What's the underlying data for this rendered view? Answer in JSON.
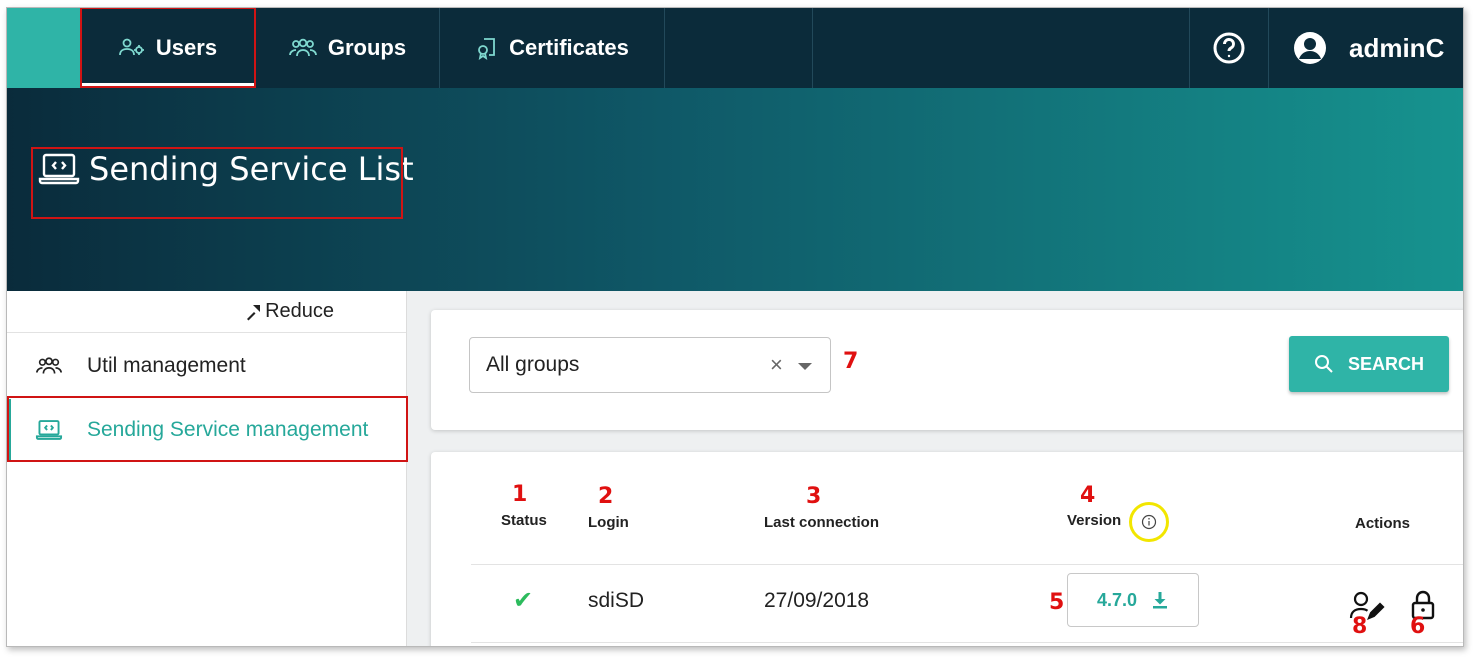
{
  "nav": {
    "tabs": [
      {
        "label": "Users",
        "icon": "users-gear-icon"
      },
      {
        "label": "Groups",
        "icon": "groups-icon"
      },
      {
        "label": "Certificates",
        "icon": "certificate-icon"
      }
    ],
    "help_icon": "help-circle-icon",
    "user_icon": "account-circle-icon",
    "user_name": "adminC"
  },
  "banner": {
    "title": "Sending Service List",
    "icon": "laptop-code-icon"
  },
  "sidebar": {
    "reduce_label": "Reduce",
    "reduce_icon": "collapse-arrows-icon",
    "items": [
      {
        "label": "Util management",
        "icon": "groups-icon"
      },
      {
        "label": "Sending Service management",
        "icon": "laptop-code-icon"
      }
    ]
  },
  "search": {
    "group_select_value": "All groups",
    "clear_symbol": "×",
    "button_label": "SEARCH"
  },
  "table": {
    "headers": {
      "status": "Status",
      "login": "Login",
      "last_connection": "Last connection",
      "version": "Version",
      "actions": "Actions"
    },
    "rows": [
      {
        "status": "✔",
        "login": "sdiSD",
        "last_connection": "27/09/2018",
        "version": "4.7.0"
      }
    ]
  },
  "annotations": {
    "status": "1",
    "login": "2",
    "last_connection": "3",
    "version": "4",
    "version_download": "5",
    "lock": "6",
    "group_select": "7",
    "edit_user": "8"
  },
  "colors": {
    "accent": "#2fb4a7",
    "topbar": "#0b2b3a",
    "annotation_red": "#e01010",
    "highlight_yellow": "#f2e600"
  }
}
